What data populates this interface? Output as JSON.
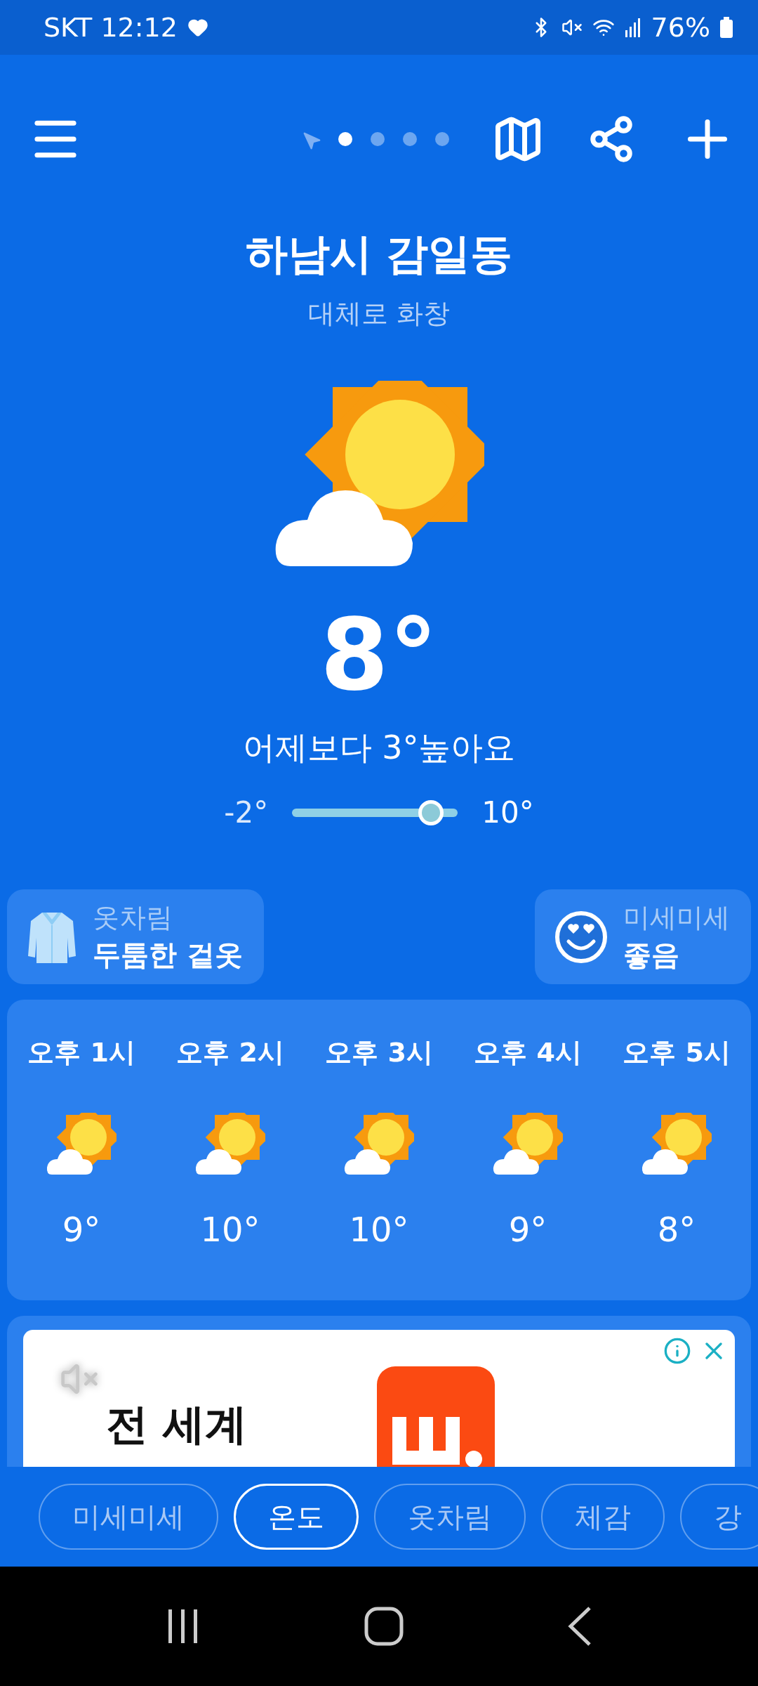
{
  "status_bar": {
    "carrier_time": "SKT 12:12",
    "battery": "76%"
  },
  "page_indicator": [
    {
      "selected": true
    },
    {
      "selected": false
    },
    {
      "selected": false
    },
    {
      "selected": false
    }
  ],
  "location": {
    "name": "하남시 감일동",
    "condition": "대체로 화창"
  },
  "current": {
    "temperature": "8°",
    "comparison": "어제보다 3°높아요",
    "low": "-2°",
    "high": "10°",
    "level": 0.84
  },
  "info_cards": [
    {
      "kind": "clothing",
      "label": "옷차림",
      "value": "두툼한 겉옷"
    },
    {
      "kind": "dust",
      "label": "미세미세",
      "value": "좋음"
    }
  ],
  "hourly": [
    {
      "time": "오후 1시",
      "temp": "9°"
    },
    {
      "time": "오후 2시",
      "temp": "10°"
    },
    {
      "time": "오후 3시",
      "temp": "10°"
    },
    {
      "time": "오후 4시",
      "temp": "9°"
    },
    {
      "time": "오후 5시",
      "temp": "8°"
    }
  ],
  "ad": {
    "headline": "전 세계"
  },
  "tabs": [
    {
      "label": "미세미세",
      "selected": false
    },
    {
      "label": "온도",
      "selected": true
    },
    {
      "label": "옷차림",
      "selected": false
    },
    {
      "label": "체감",
      "selected": false
    },
    {
      "label": "강",
      "selected": false
    }
  ]
}
